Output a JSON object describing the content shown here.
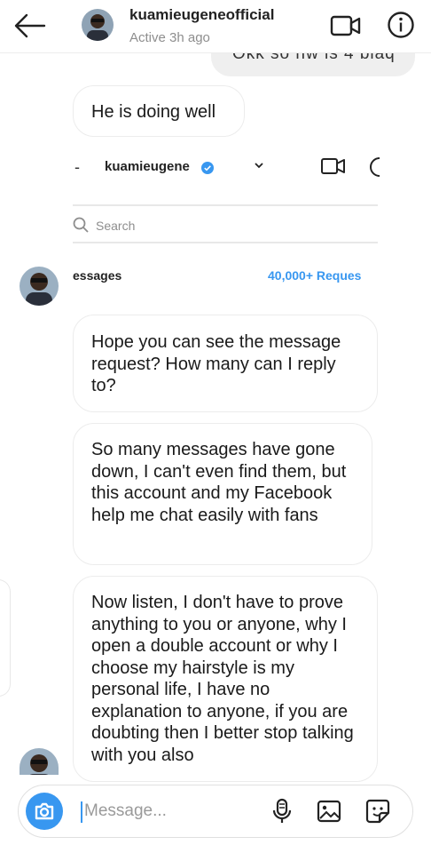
{
  "header": {
    "username": "kuamieugeneofficial",
    "status": "Active 3h ago"
  },
  "outgoing_partial": "Okk so nw is 4 blaq",
  "messages": [
    "He is doing well",
    "Hope you can see the message request? How many can I reply to?",
    "So many messages have gone down, I can't even find them, but this account and my Facebook help me chat easily with fans",
    "Now listen, I don't have to prove anything to you or anyone, why I open a double account or why I choose my hairstyle is my personal life, I have no explanation to anyone, if you are doubting then I better stop talking with you also"
  ],
  "embedded_screenshot": {
    "dash": "-",
    "username": "kuamieugene",
    "search_placeholder": "Search",
    "messages_label": "essages",
    "requests_label": "40,000+ Reques"
  },
  "composer": {
    "placeholder": "Message..."
  },
  "colors": {
    "accent": "#3897f0",
    "bubble_border": "#ececec",
    "outgoing_bg": "#efefef",
    "muted_text": "#8e8e8e"
  },
  "icons": {
    "back": "arrow-left-icon",
    "video": "video-camera-icon",
    "info": "info-circle-icon",
    "camera": "camera-icon",
    "mic": "microphone-icon",
    "gallery": "image-gallery-icon",
    "sticker": "sticker-icon",
    "verified": "verified-badge-icon"
  }
}
